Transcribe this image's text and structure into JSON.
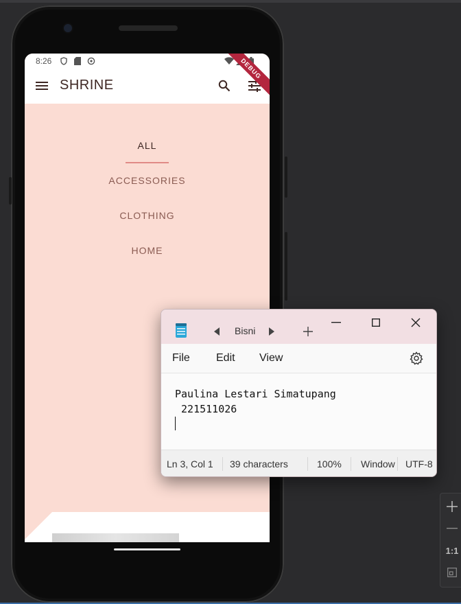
{
  "phone": {
    "status": {
      "time": "8:26"
    },
    "appbar": {
      "title": "SHRINE",
      "debug_label": "DEBUG"
    },
    "categories": [
      {
        "label": "ALL",
        "active": true
      },
      {
        "label": "ACCESSORIES",
        "active": false
      },
      {
        "label": "CLOTHING",
        "active": false
      },
      {
        "label": "HOME",
        "active": false
      }
    ],
    "colors": {
      "backdrop": "#fbdcd3",
      "accent": "#e08a86",
      "text": "#3e2723",
      "debug": "#b3263e"
    }
  },
  "notepad": {
    "tab_title": "Bisni",
    "menu": [
      "File",
      "Edit",
      "View"
    ],
    "content_lines": [
      "Paulina Lestari Simatupang",
      " 221511026"
    ],
    "status": {
      "position": "Ln 3, Col 1",
      "chars": "39 characters",
      "zoom": "100%",
      "line_ending": "Window",
      "encoding": "UTF-8"
    },
    "colors": {
      "titlebar": "#f2dfe3"
    }
  },
  "emulator_toolbar": {
    "one_to_one": "1:1"
  }
}
